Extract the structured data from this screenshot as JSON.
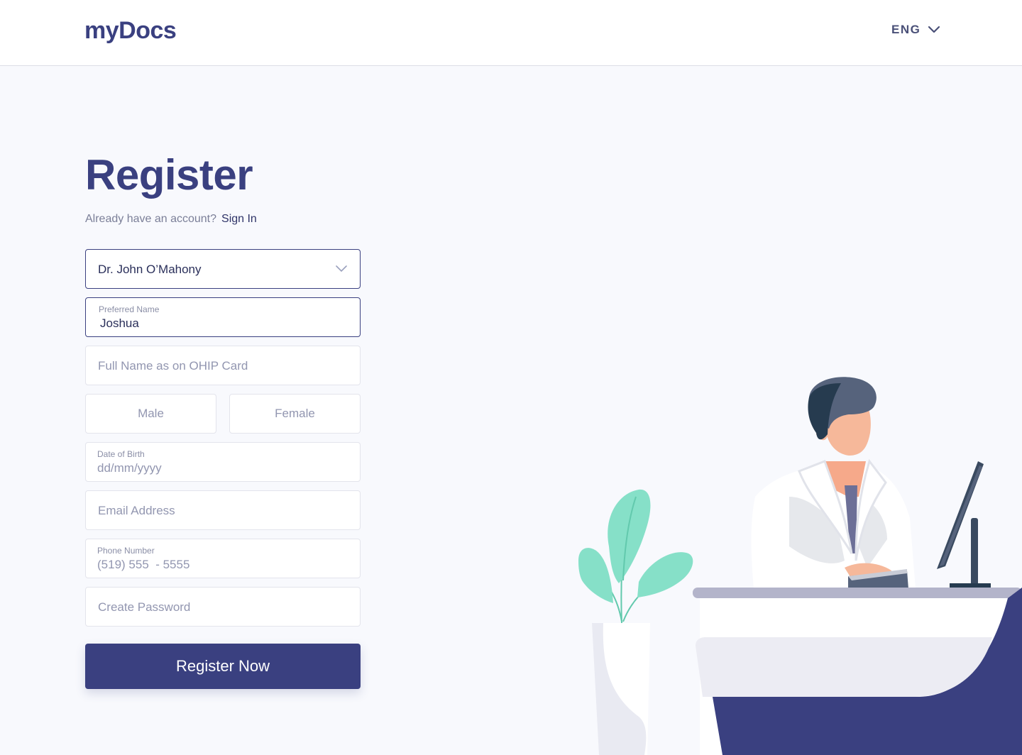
{
  "header": {
    "logo": "myDocs",
    "language": "ENG"
  },
  "page": {
    "title": "Register",
    "signin_question": "Already have an account?",
    "signin_link": "Sign In"
  },
  "form": {
    "doctor_select": {
      "value": "Dr. John O’Mahony"
    },
    "preferred_name": {
      "label": "Preferred Name",
      "value": "Joshua"
    },
    "full_name": {
      "placeholder": "Full Name as on OHIP Card"
    },
    "gender": {
      "male": "Male",
      "female": "Female"
    },
    "dob": {
      "label": "Date of Birth",
      "placeholder": "dd/mm/yyyy"
    },
    "email": {
      "placeholder": "Email Address"
    },
    "phone": {
      "label": "Phone Number",
      "placeholder": "(519) 555  - 5555"
    },
    "password": {
      "placeholder": "Create Password"
    },
    "submit_label": "Register Now"
  },
  "colors": {
    "brand": "#3a4080",
    "background": "#f8f9fd",
    "leaf": "#7fdcc4",
    "desk_accent": "#3a4080"
  }
}
